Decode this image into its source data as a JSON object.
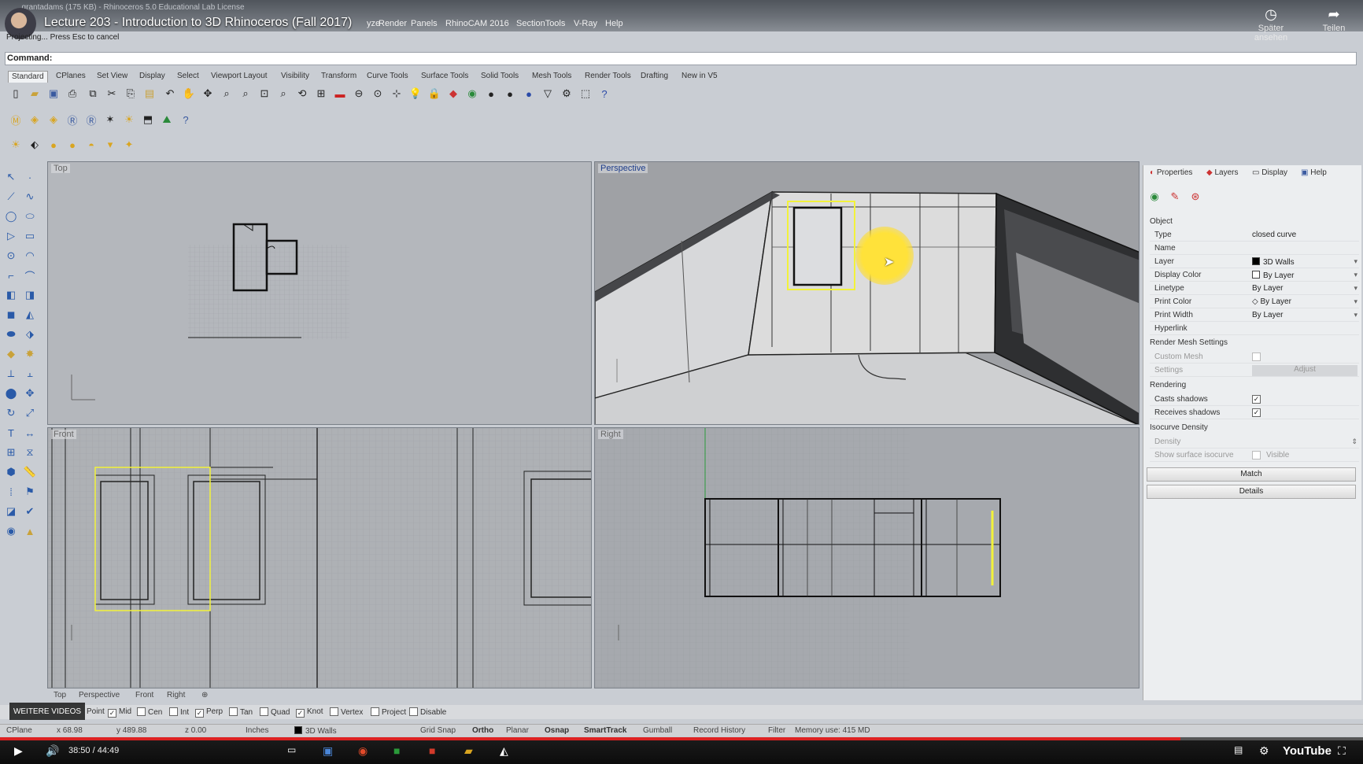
{
  "window": {
    "title": "_grantadams (175 KB) - Rhinoceros 5.0 Educational Lab License",
    "video_title": "Lecture 203 - Introduction to 3D Rhinoceros (Fall 2017)",
    "watch_later": "Später ansehen",
    "share": "Teilen"
  },
  "menu": [
    "yze",
    "Render",
    "Panels",
    "RhinoCAM 2016",
    "SectionTools",
    "V-Ray",
    "Help"
  ],
  "status_message": "Projecting... Press Esc to cancel",
  "command": {
    "label": "Command:"
  },
  "toolbar_tabs": [
    "Standard",
    "CPlanes",
    "Set View",
    "Display",
    "Select",
    "Viewport Layout",
    "Visibility",
    "Transform",
    "Curve Tools",
    "Surface Tools",
    "Solid Tools",
    "Mesh Tools",
    "Render Tools",
    "Drafting",
    "New in V5"
  ],
  "viewports": {
    "top": "Top",
    "perspective": "Perspective",
    "front": "Front",
    "right": "Right"
  },
  "viewport_tabs": [
    "Top",
    "Perspective",
    "Front",
    "Right"
  ],
  "osnaps": [
    {
      "label": "Point",
      "checked": true
    },
    {
      "label": "Mid",
      "checked": true
    },
    {
      "label": "Cen",
      "checked": false
    },
    {
      "label": "Int",
      "checked": false
    },
    {
      "label": "Perp",
      "checked": true
    },
    {
      "label": "Tan",
      "checked": false
    },
    {
      "label": "Quad",
      "checked": false
    },
    {
      "label": "Knot",
      "checked": true
    },
    {
      "label": "Vertex",
      "checked": false
    },
    {
      "label": "Project",
      "checked": false
    },
    {
      "label": "Disable",
      "checked": false
    }
  ],
  "more_videos": "WEITERE VIDEOS",
  "statusbar": {
    "cplane": "CPlane",
    "x": "x 68.98",
    "y": "y 489.88",
    "z": "z 0.00",
    "units": "Inches",
    "layer": "3D Walls",
    "grid_snap": "Grid Snap",
    "ortho": "Ortho",
    "planar": "Planar",
    "osnap": "Osnap",
    "smarttrack": "SmartTrack",
    "gumball": "Gumball",
    "record_history": "Record History",
    "filter": "Filter",
    "memory": "Memory use: 415 MD"
  },
  "panel": {
    "tabs": [
      "Properties",
      "Layers",
      "Display",
      "Help"
    ],
    "object_header": "Object",
    "rows": [
      {
        "k": "Type",
        "v": "closed curve"
      },
      {
        "k": "Name",
        "v": ""
      },
      {
        "k": "Layer",
        "v": "3D Walls"
      },
      {
        "k": "Display Color",
        "v": "By Layer"
      },
      {
        "k": "Linetype",
        "v": "By Layer"
      },
      {
        "k": "Print Color",
        "v": "By Layer"
      },
      {
        "k": "Print Width",
        "v": "By Layer"
      },
      {
        "k": "Hyperlink",
        "v": ""
      }
    ],
    "render_mesh_header": "Render Mesh Settings",
    "custom_mesh": "Custom Mesh",
    "settings": "Settings",
    "adjust": "Adjust",
    "rendering_header": "Rendering",
    "casts_shadows": "Casts shadows",
    "receives_shadows": "Receives shadows",
    "isocurve_header": "Isocurve Density",
    "density": "Density",
    "show_isocurve": "Show surface isocurve",
    "visible": "Visible",
    "match": "Match",
    "details": "Details"
  },
  "player": {
    "time": "38:50 / 44:49",
    "progress": 0.866,
    "youtube": "YouTube"
  },
  "colors": {
    "accent_selected": "#f2f23a",
    "progress": "#dd2222"
  }
}
